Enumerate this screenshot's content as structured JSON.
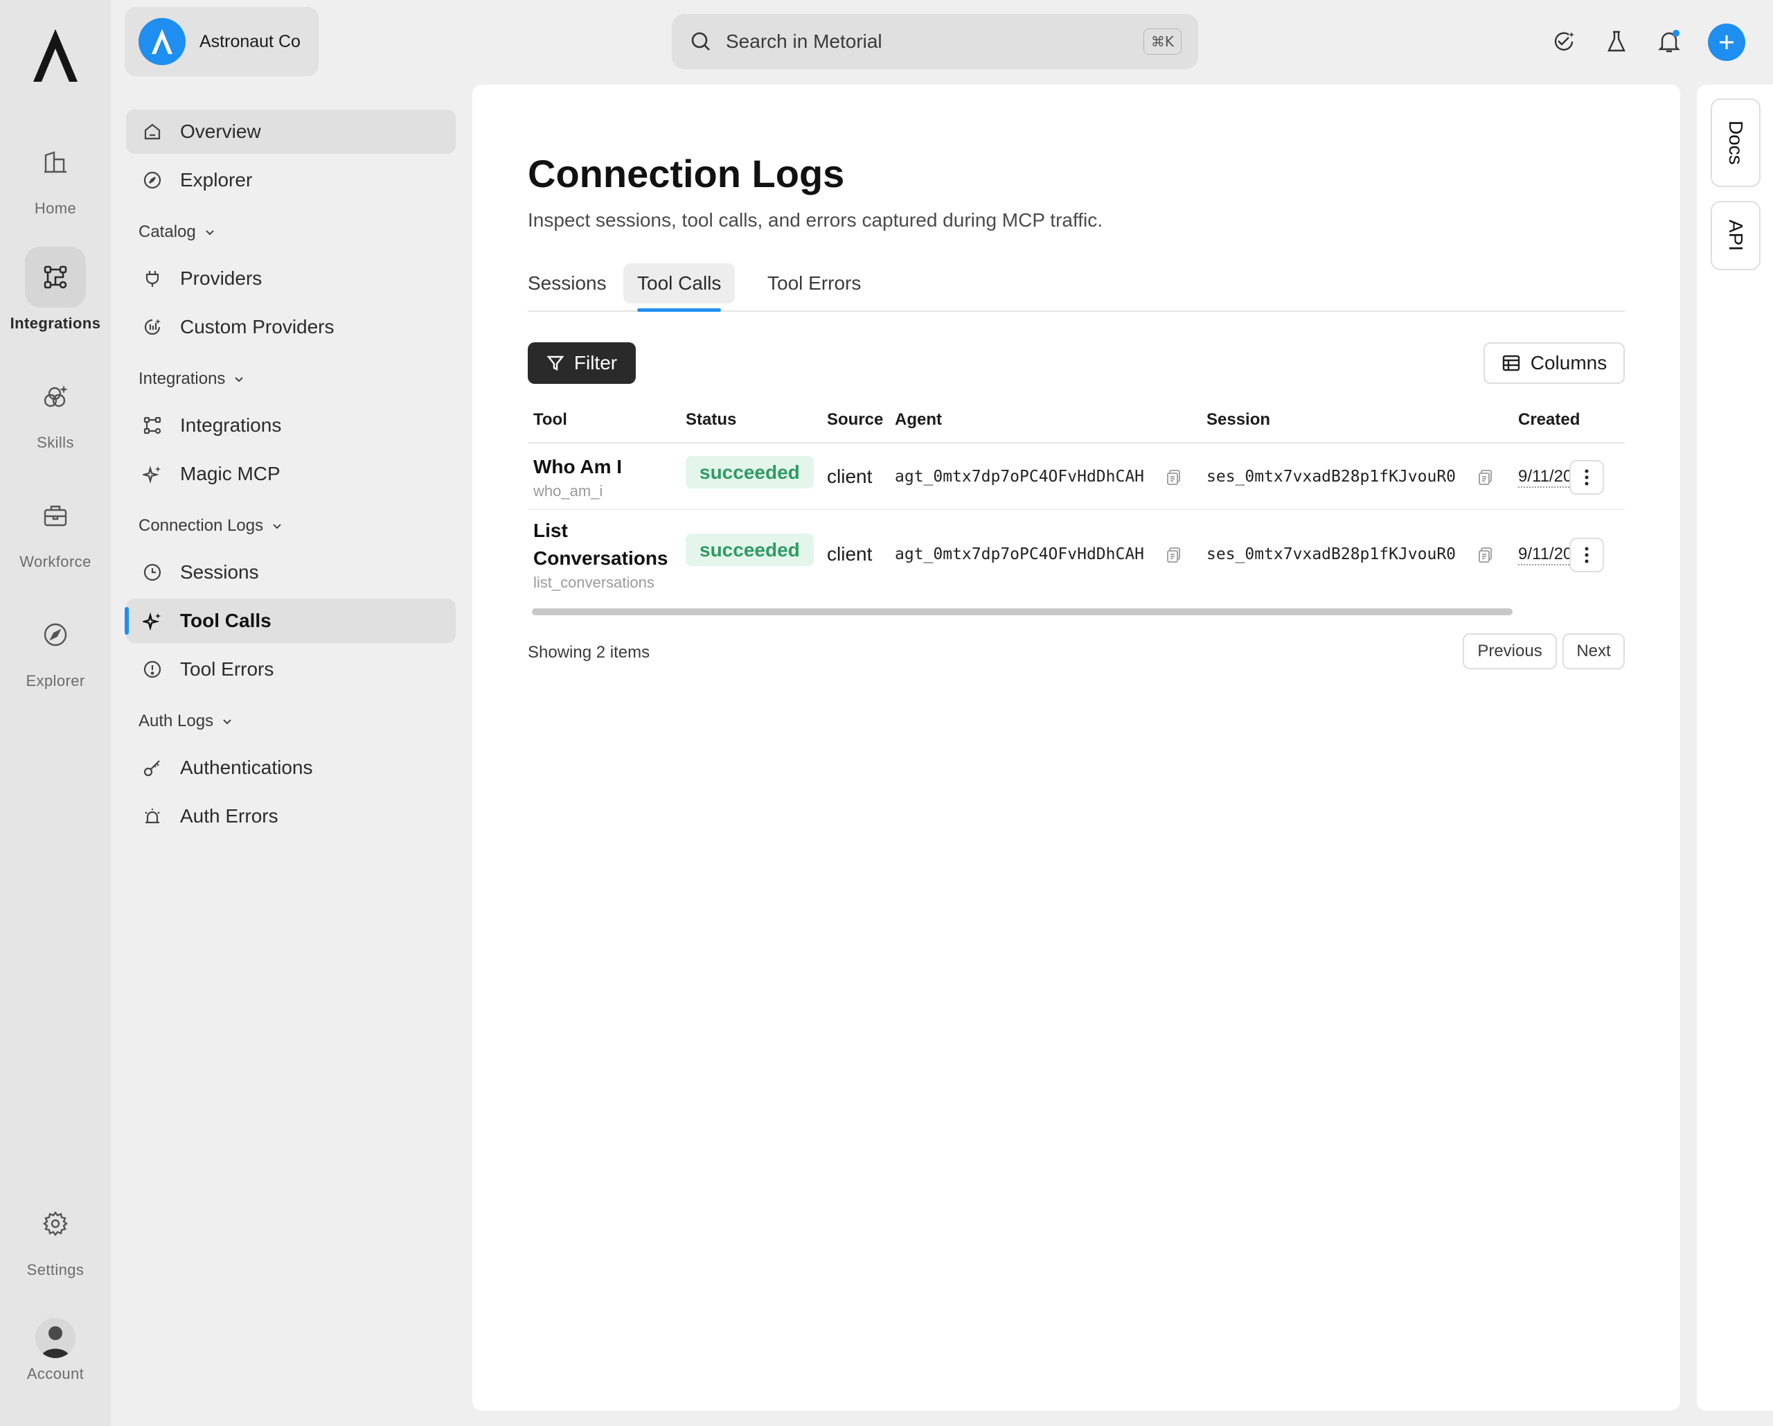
{
  "rail": {
    "items": [
      {
        "label": "Home",
        "icon": "home-icon"
      },
      {
        "label": "Integrations",
        "icon": "integrations-icon"
      },
      {
        "label": "Skills",
        "icon": "skills-icon"
      },
      {
        "label": "Workforce",
        "icon": "briefcase-icon"
      },
      {
        "label": "Explorer",
        "icon": "compass-icon"
      }
    ],
    "settings_label": "Settings",
    "account_label": "Account"
  },
  "org": {
    "name": "Astronaut Co"
  },
  "search": {
    "placeholder": "Search in Metorial",
    "shortcut": "⌘K"
  },
  "sidebar": {
    "top": [
      {
        "label": "Overview",
        "icon": "home-icon"
      },
      {
        "label": "Explorer",
        "icon": "compass-icon"
      }
    ],
    "catalog": {
      "title": "Catalog",
      "items": [
        {
          "label": "Providers",
          "icon": "plug-icon"
        },
        {
          "label": "Custom Providers",
          "icon": "custom-provider-icon"
        }
      ]
    },
    "integrations": {
      "title": "Integrations",
      "items": [
        {
          "label": "Integrations",
          "icon": "integrations-icon"
        },
        {
          "label": "Magic MCP",
          "icon": "sparkles-icon"
        }
      ]
    },
    "connection_logs": {
      "title": "Connection Logs",
      "items": [
        {
          "label": "Sessions",
          "icon": "clock-icon"
        },
        {
          "label": "Tool Calls",
          "icon": "sparkles-icon"
        },
        {
          "label": "Tool Errors",
          "icon": "alert-circle-icon"
        }
      ]
    },
    "auth_logs": {
      "title": "Auth Logs",
      "items": [
        {
          "label": "Authentications",
          "icon": "key-icon"
        },
        {
          "label": "Auth Errors",
          "icon": "siren-icon"
        }
      ]
    }
  },
  "page": {
    "title": "Connection Logs",
    "subtitle": "Inspect sessions, tool calls, and errors captured during MCP traffic.",
    "tabs": [
      "Sessions",
      "Tool Calls",
      "Tool Errors"
    ],
    "active_tab": "Tool Calls",
    "filter_label": "Filter",
    "columns_label": "Columns",
    "table": {
      "headers": [
        "Tool",
        "Status",
        "Source",
        "Agent",
        "Session",
        "Created"
      ],
      "rows": [
        {
          "tool_name": "Who Am I",
          "tool_key": "who_am_i",
          "status": "succeeded",
          "source": "client",
          "agent": "agt_0mtx7dp7oPC4OFvHdDhCAH",
          "session": "ses_0mtx7vxadB28p1fKJvouR0",
          "created": "9/11/20"
        },
        {
          "tool_name": "List Conversations",
          "tool_key": "list_conversations",
          "status": "succeeded",
          "source": "client",
          "agent": "agt_0mtx7dp7oPC4OFvHdDhCAH",
          "session": "ses_0mtx7vxadB28p1fKJvouR0",
          "created": "9/11/20"
        }
      ]
    },
    "showing": "Showing 2 items",
    "prev_label": "Previous",
    "next_label": "Next"
  },
  "right_panel": {
    "docs_label": "Docs",
    "api_label": "API"
  },
  "colors": {
    "accent": "#1f8ef1",
    "success_bg": "#e4f6ec",
    "success_text": "#2f9b62"
  }
}
